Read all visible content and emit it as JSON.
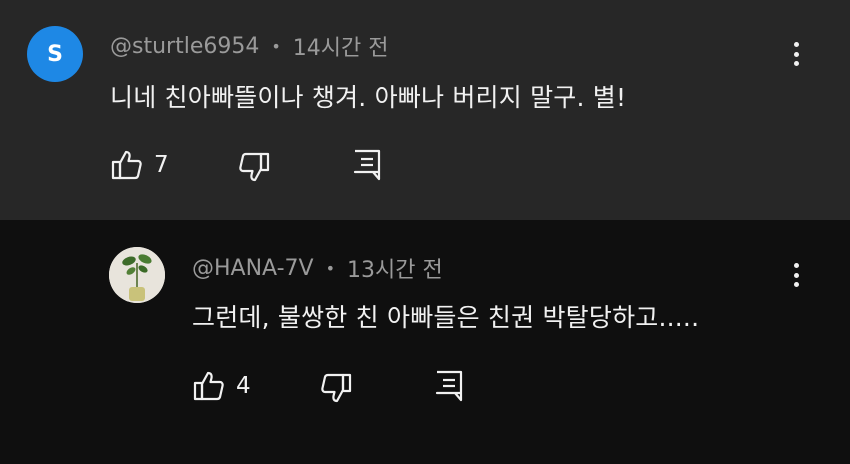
{
  "comments": [
    {
      "avatar_letter": "S",
      "avatar_color": "#1e88e5",
      "author": "@sturtle6954",
      "separator": "•",
      "time": "14시간 전",
      "text": "니네 친아빠뜰이나 챙겨. 아빠나 버리지 말구. 별!",
      "likes": "7",
      "icons": [
        "thumb-up-icon",
        "thumb-down-icon",
        "reply-icon",
        "more-vert-icon"
      ]
    },
    {
      "avatar_image": "plant-photo",
      "author": "@HANA-7V",
      "separator": "•",
      "time": "13시간 전",
      "text": "그런데, 불쌍한 친 아빠들은 친권 박탈당하고.....",
      "likes": "4",
      "icons": [
        "thumb-up-icon",
        "thumb-down-icon",
        "reply-icon",
        "more-vert-icon"
      ]
    }
  ],
  "colors": {
    "top_comment_bg": "#272727",
    "reply_bg": "#0f0f0f",
    "meta_text": "#9a9a9a",
    "primary_text": "#f1f1f1"
  }
}
